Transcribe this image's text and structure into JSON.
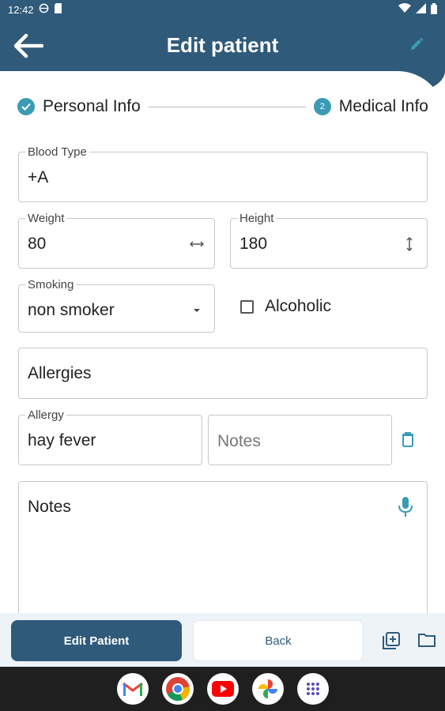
{
  "status_bar": {
    "time": "12:42"
  },
  "header": {
    "title": "Edit patient"
  },
  "stepper": {
    "steps": [
      {
        "label": "Personal Info",
        "state": "completed"
      },
      {
        "label": "Medical Info",
        "state": "current",
        "number": "2"
      }
    ]
  },
  "form": {
    "blood_type": {
      "label": "Blood Type",
      "value": "+A"
    },
    "weight": {
      "label": "Weight",
      "value": "80"
    },
    "height": {
      "label": "Height",
      "value": "180"
    },
    "smoking": {
      "label": "Smoking",
      "value": "non smoker"
    },
    "alcoholic": {
      "label": "Alcoholic",
      "checked": false
    },
    "allergies_header": "Allergies",
    "allergy": {
      "label": "Allergy",
      "value": "hay fever"
    },
    "allergy_notes": {
      "placeholder": "Notes"
    },
    "notes": {
      "label": "Notes"
    }
  },
  "bottom_bar": {
    "primary_label": "Edit Patient",
    "secondary_label": "Back"
  },
  "colors": {
    "primary": "#2f5a7a",
    "accent": "#3a9bb5"
  }
}
